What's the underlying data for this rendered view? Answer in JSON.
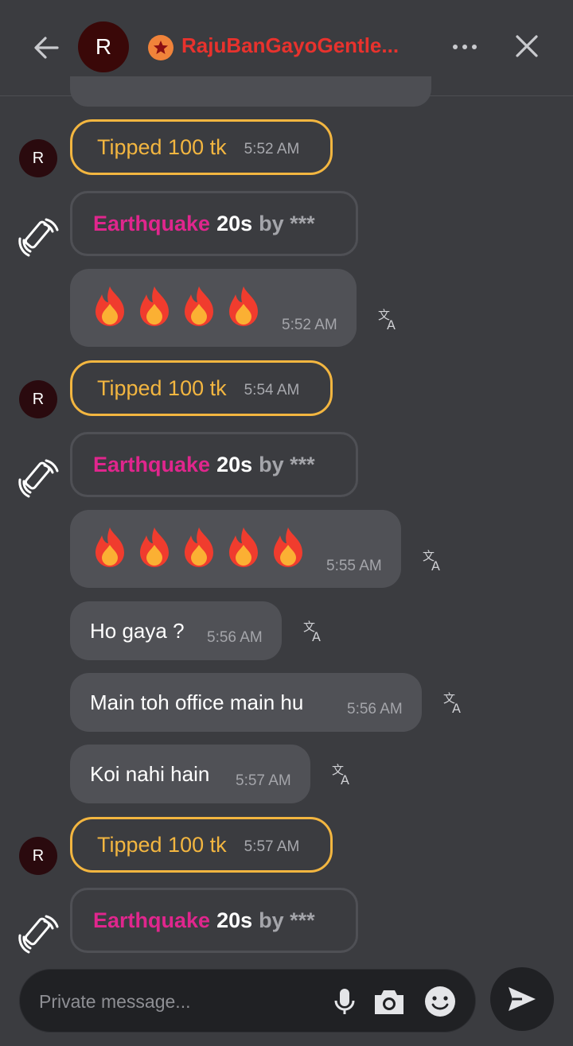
{
  "header": {
    "avatar_letter": "R",
    "username": "RajuBanGayoGentle...",
    "name_color": "#e8322d",
    "badge_icon": "star-icon"
  },
  "messages": [
    {
      "type": "tip",
      "avatar": "R",
      "label": "Tipped 100 tk",
      "time": "5:52 AM"
    },
    {
      "type": "gift",
      "icon": "vibration-icon",
      "name": "Earthquake",
      "duration": "20s",
      "by": "by ***"
    },
    {
      "type": "emoji",
      "emoji": "🔥",
      "count": 4,
      "time": "5:52 AM"
    },
    {
      "type": "tip",
      "avatar": "R",
      "label": "Tipped 100 tk",
      "time": "5:54 AM"
    },
    {
      "type": "gift",
      "icon": "vibration-icon",
      "name": "Earthquake",
      "duration": "20s",
      "by": "by ***"
    },
    {
      "type": "emoji",
      "emoji": "🔥",
      "count": 5,
      "time": "5:55 AM"
    },
    {
      "type": "text",
      "text": "Ho gaya ?",
      "time": "5:56 AM"
    },
    {
      "type": "text",
      "text": "Main toh office main hu",
      "time": "5:56 AM"
    },
    {
      "type": "text",
      "text": "Koi nahi hain",
      "time": "5:57 AM"
    },
    {
      "type": "tip",
      "avatar": "R",
      "label": "Tipped 100 tk",
      "time": "5:57 AM"
    },
    {
      "type": "gift",
      "icon": "vibration-icon",
      "name": "Earthquake",
      "duration": "20s",
      "by": "by ***"
    }
  ],
  "composer": {
    "placeholder": "Private message...",
    "icons": [
      "microphone-icon",
      "camera-icon",
      "emoji-icon"
    ],
    "send_icon": "send-icon"
  },
  "colors": {
    "background": "#3b3c40",
    "tip_border": "#f3b640",
    "gift_name": "#e0268d",
    "bubble": "#505156"
  }
}
